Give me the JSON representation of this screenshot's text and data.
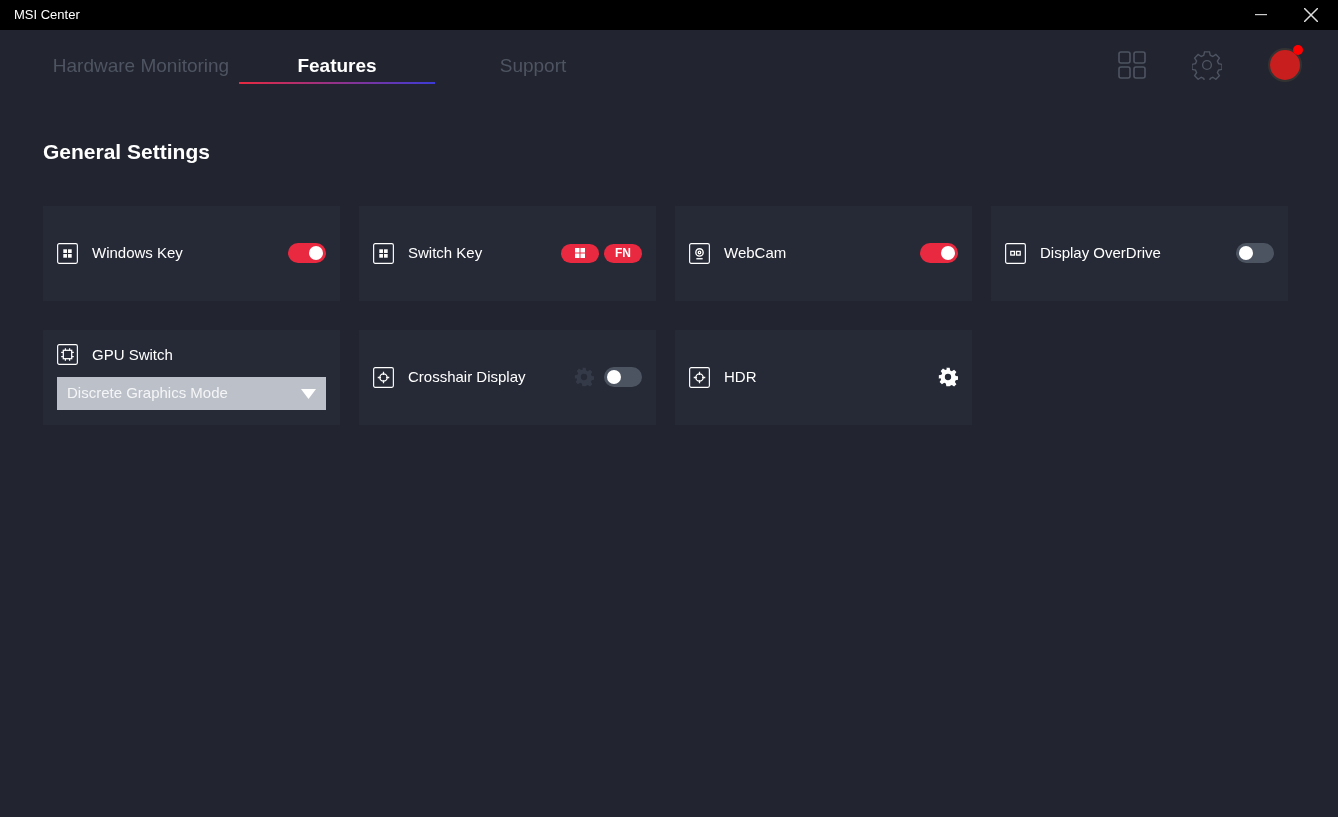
{
  "window": {
    "title": "MSI Center"
  },
  "tabs": [
    {
      "label": "Hardware Monitoring",
      "selected": false
    },
    {
      "label": "Features",
      "selected": true
    },
    {
      "label": "Support",
      "selected": false
    }
  ],
  "profile": {
    "notification": true
  },
  "section_title": "General Settings",
  "cards": [
    {
      "kind": "toggle",
      "label": "Windows Key",
      "on": true
    },
    {
      "kind": "keys",
      "label": "Switch Key",
      "key_label": "FN"
    },
    {
      "kind": "toggle",
      "label": "WebCam",
      "on": true
    },
    {
      "kind": "toggle",
      "label": "Display OverDrive",
      "on": false
    },
    {
      "kind": "dropdown",
      "label": "GPU Switch",
      "value": "Discrete Graphics Mode"
    },
    {
      "kind": "toggle_gear",
      "label": "Crosshair Display",
      "on": false,
      "gear_disabled": true
    },
    {
      "kind": "gear",
      "label": "HDR",
      "gear_disabled": false
    }
  ]
}
